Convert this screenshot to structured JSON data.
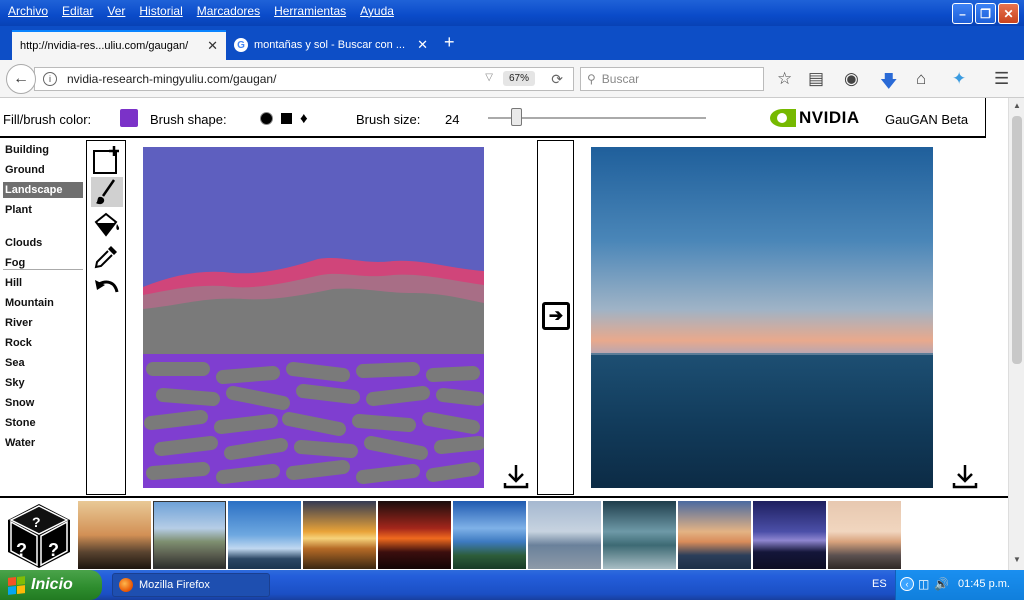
{
  "menu": [
    "Archivo",
    "Editar",
    "Ver",
    "Historial",
    "Marcadores",
    "Herramientas",
    "Ayuda"
  ],
  "tabs": [
    {
      "label": "http://nvidia-res...uliu.com/gaugan/",
      "active": true
    },
    {
      "label": "montañas y sol - Buscar con ...",
      "active": false
    }
  ],
  "nav": {
    "url": "nvidia-research-mingyuliu.com/gaugan/",
    "zoom": "67%",
    "search_placeholder": "Buscar"
  },
  "toolbar": {
    "fill_label": "Fill/brush color:",
    "fill_color": "#7b32c8",
    "brush_shape_label": "Brush shape:",
    "brush_size_label": "Brush size:",
    "brush_size_value": "24",
    "brand": "NVIDIA",
    "app_title": "GauGAN Beta"
  },
  "labels_group1": [
    "Building",
    "Ground",
    "Landscape",
    "Plant"
  ],
  "labels_group2": [
    "Clouds",
    "Fog",
    "Hill",
    "Mountain",
    "River",
    "Rock",
    "Sea",
    "Sky",
    "Snow",
    "Stone",
    "Water"
  ],
  "selected_label": "Landscape",
  "tools": [
    "new-canvas-icon",
    "brush-icon",
    "paint-bucket-icon",
    "eyedropper-icon",
    "undo-icon"
  ],
  "taskbar": {
    "start": "Inicio",
    "window": "Mozilla Firefox",
    "lang": "ES",
    "clock": "01:45 p.m."
  }
}
